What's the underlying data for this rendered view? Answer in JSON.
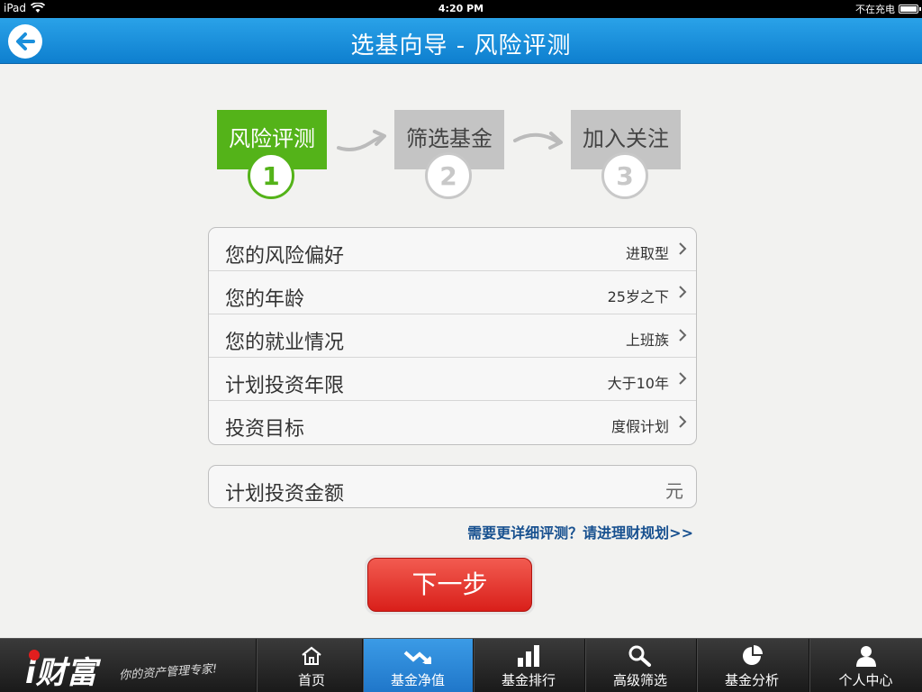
{
  "statusbar": {
    "device": "iPad",
    "time": "4:20 PM",
    "charging": "不在充电"
  },
  "navbar": {
    "title": "选基向导 - 风险评测"
  },
  "steps": [
    {
      "label": "风险评测",
      "number": "1",
      "active": true
    },
    {
      "label": "筛选基金",
      "number": "2",
      "active": false
    },
    {
      "label": "加入关注",
      "number": "3",
      "active": false
    }
  ],
  "form": {
    "rows": [
      {
        "label": "您的风险偏好",
        "value": "进取型"
      },
      {
        "label": "您的年龄",
        "value": "25岁之下"
      },
      {
        "label": "您的就业情况",
        "value": "上班族"
      },
      {
        "label": "计划投资年限",
        "value": "大于10年"
      },
      {
        "label": "投资目标",
        "value": "度假计划"
      }
    ],
    "amount": {
      "label": "计划投资金额",
      "value": "",
      "unit": "元"
    }
  },
  "link_text": "需要更详细评测？请进理财规划>>",
  "next_button": "下一步",
  "tabbar": {
    "logo": "i财富",
    "slogan": "你的资产管理专家!",
    "tabs": [
      {
        "label": "首页",
        "icon": "home-icon"
      },
      {
        "label": "基金净值",
        "icon": "trend-icon",
        "active": true
      },
      {
        "label": "基金排行",
        "icon": "bar-chart-icon"
      },
      {
        "label": "高级筛选",
        "icon": "search-icon"
      },
      {
        "label": "基金分析",
        "icon": "pie-chart-icon"
      },
      {
        "label": "个人中心",
        "icon": "user-icon"
      }
    ]
  },
  "colors": {
    "nav_blue": "#1a8fdc",
    "step_green": "#54b319",
    "button_red": "#e03a30",
    "link_blue": "#17508f"
  }
}
